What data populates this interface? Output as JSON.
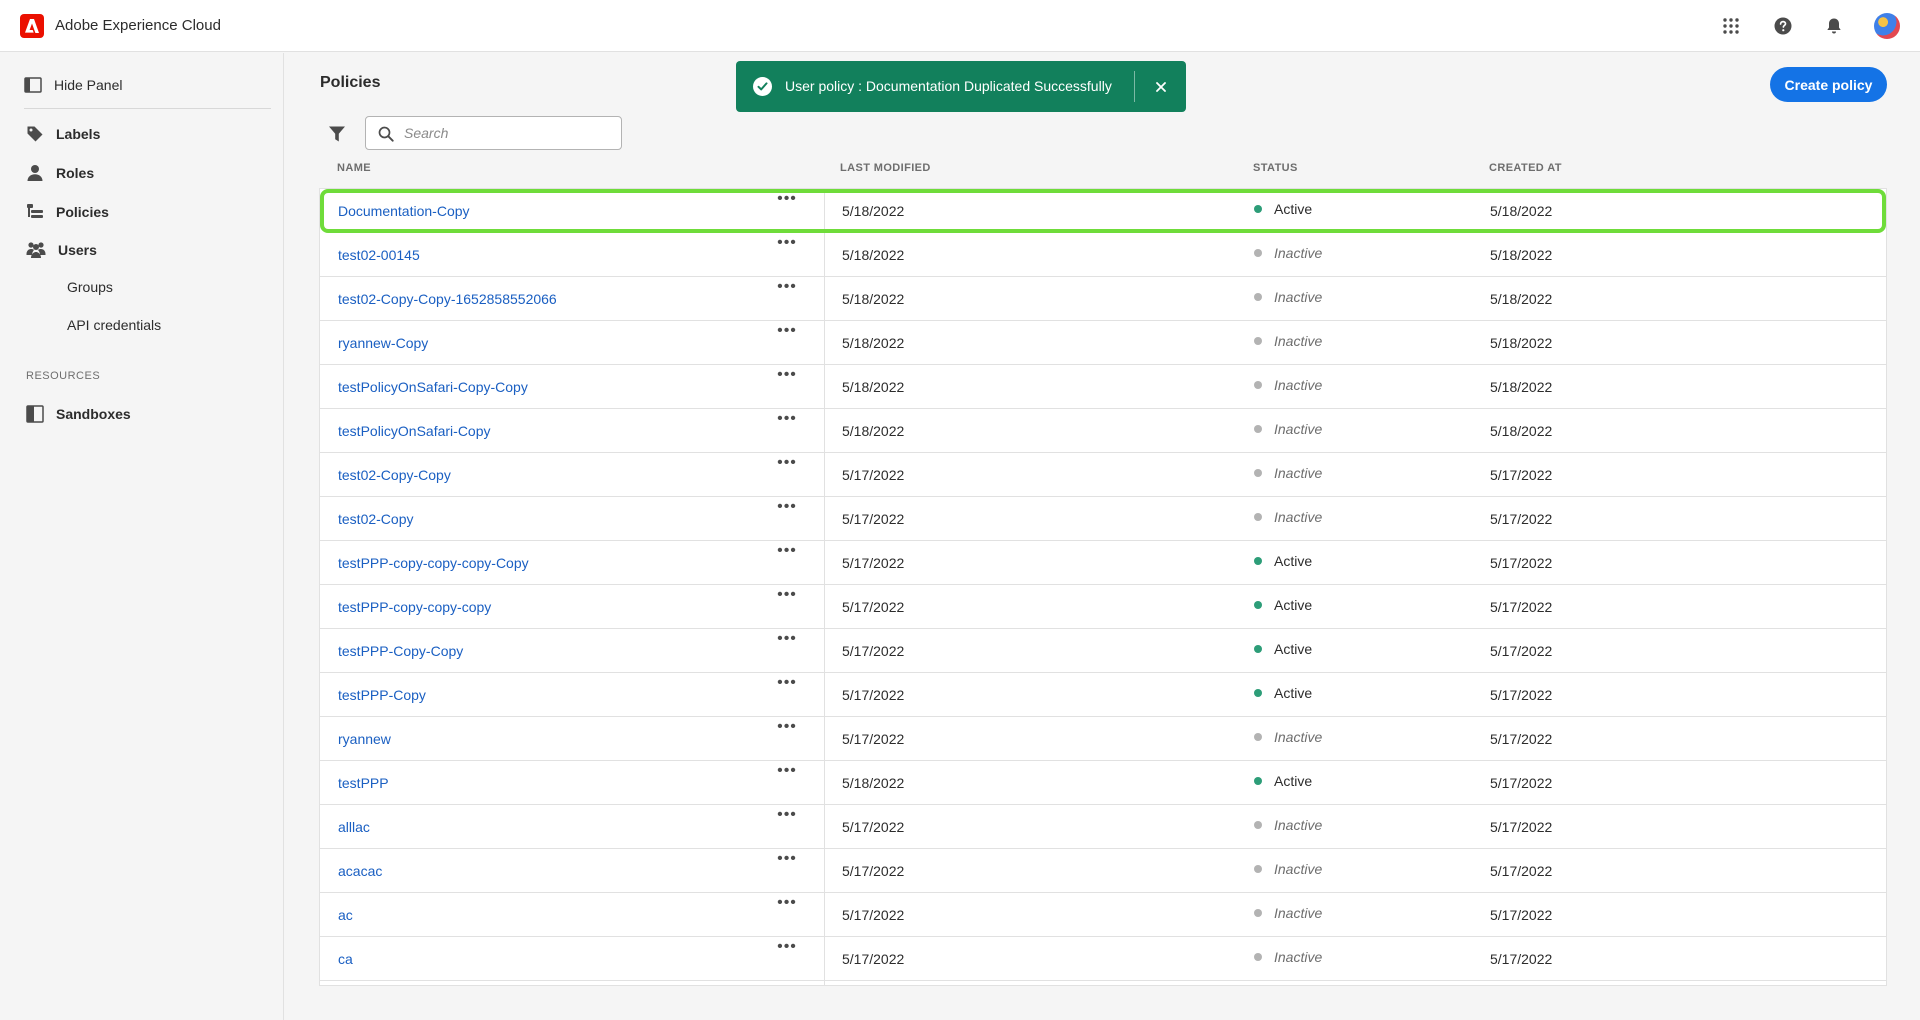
{
  "header": {
    "brand": "Adobe Experience Cloud",
    "icons": [
      "apps-grid-icon",
      "help-icon",
      "bell-icon"
    ],
    "brand_color": "#eb1000"
  },
  "sidebar": {
    "hide_panel": "Hide Panel",
    "items": [
      {
        "label": "Labels",
        "icon": "tag-icon"
      },
      {
        "label": "Roles",
        "icon": "person-icon"
      },
      {
        "label": "Policies",
        "icon": "policies-icon"
      },
      {
        "label": "Users",
        "icon": "users-icon"
      }
    ],
    "subitems": [
      {
        "label": "Groups"
      },
      {
        "label": "API credentials"
      }
    ],
    "resources_label": "RESOURCES",
    "resources": [
      {
        "label": "Sandboxes",
        "icon": "sandbox-icon"
      }
    ]
  },
  "main": {
    "title": "Policies",
    "create_button": "Create policy",
    "search_placeholder": "Search",
    "accent_color": "#1473e6",
    "toast": {
      "message": "User policy : Documentation Duplicated Successfully",
      "color": "#12805c"
    },
    "columns": {
      "name": "NAME",
      "last_modified": "LAST MODIFIED",
      "status": "STATUS",
      "created_at": "CREATED AT"
    },
    "status_colors": {
      "Active": "#2d9d78",
      "Inactive": "#b3b3b3"
    },
    "rows": [
      {
        "name": "Documentation-Copy",
        "last_modified": "5/18/2022",
        "status": "Active",
        "created_at": "5/18/2022",
        "highlighted": true
      },
      {
        "name": "test02-00145",
        "last_modified": "5/18/2022",
        "status": "Inactive",
        "created_at": "5/18/2022"
      },
      {
        "name": "test02-Copy-Copy-1652858552066",
        "last_modified": "5/18/2022",
        "status": "Inactive",
        "created_at": "5/18/2022"
      },
      {
        "name": "ryannew-Copy",
        "last_modified": "5/18/2022",
        "status": "Inactive",
        "created_at": "5/18/2022"
      },
      {
        "name": "testPolicyOnSafari-Copy-Copy",
        "last_modified": "5/18/2022",
        "status": "Inactive",
        "created_at": "5/18/2022"
      },
      {
        "name": "testPolicyOnSafari-Copy",
        "last_modified": "5/18/2022",
        "status": "Inactive",
        "created_at": "5/18/2022"
      },
      {
        "name": "test02-Copy-Copy",
        "last_modified": "5/17/2022",
        "status": "Inactive",
        "created_at": "5/17/2022"
      },
      {
        "name": "test02-Copy",
        "last_modified": "5/17/2022",
        "status": "Inactive",
        "created_at": "5/17/2022"
      },
      {
        "name": "testPPP-copy-copy-copy-Copy",
        "last_modified": "5/17/2022",
        "status": "Active",
        "created_at": "5/17/2022"
      },
      {
        "name": "testPPP-copy-copy-copy",
        "last_modified": "5/17/2022",
        "status": "Active",
        "created_at": "5/17/2022"
      },
      {
        "name": "testPPP-Copy-Copy",
        "last_modified": "5/17/2022",
        "status": "Active",
        "created_at": "5/17/2022"
      },
      {
        "name": "testPPP-Copy",
        "last_modified": "5/17/2022",
        "status": "Active",
        "created_at": "5/17/2022"
      },
      {
        "name": "ryannew",
        "last_modified": "5/17/2022",
        "status": "Inactive",
        "created_at": "5/17/2022"
      },
      {
        "name": "testPPP",
        "last_modified": "5/18/2022",
        "status": "Active",
        "created_at": "5/17/2022"
      },
      {
        "name": "alllac",
        "last_modified": "5/17/2022",
        "status": "Inactive",
        "created_at": "5/17/2022"
      },
      {
        "name": "acacac",
        "last_modified": "5/17/2022",
        "status": "Inactive",
        "created_at": "5/17/2022"
      },
      {
        "name": "ac",
        "last_modified": "5/17/2022",
        "status": "Inactive",
        "created_at": "5/17/2022"
      },
      {
        "name": "ca",
        "last_modified": "5/17/2022",
        "status": "Inactive",
        "created_at": "5/17/2022"
      }
    ]
  }
}
